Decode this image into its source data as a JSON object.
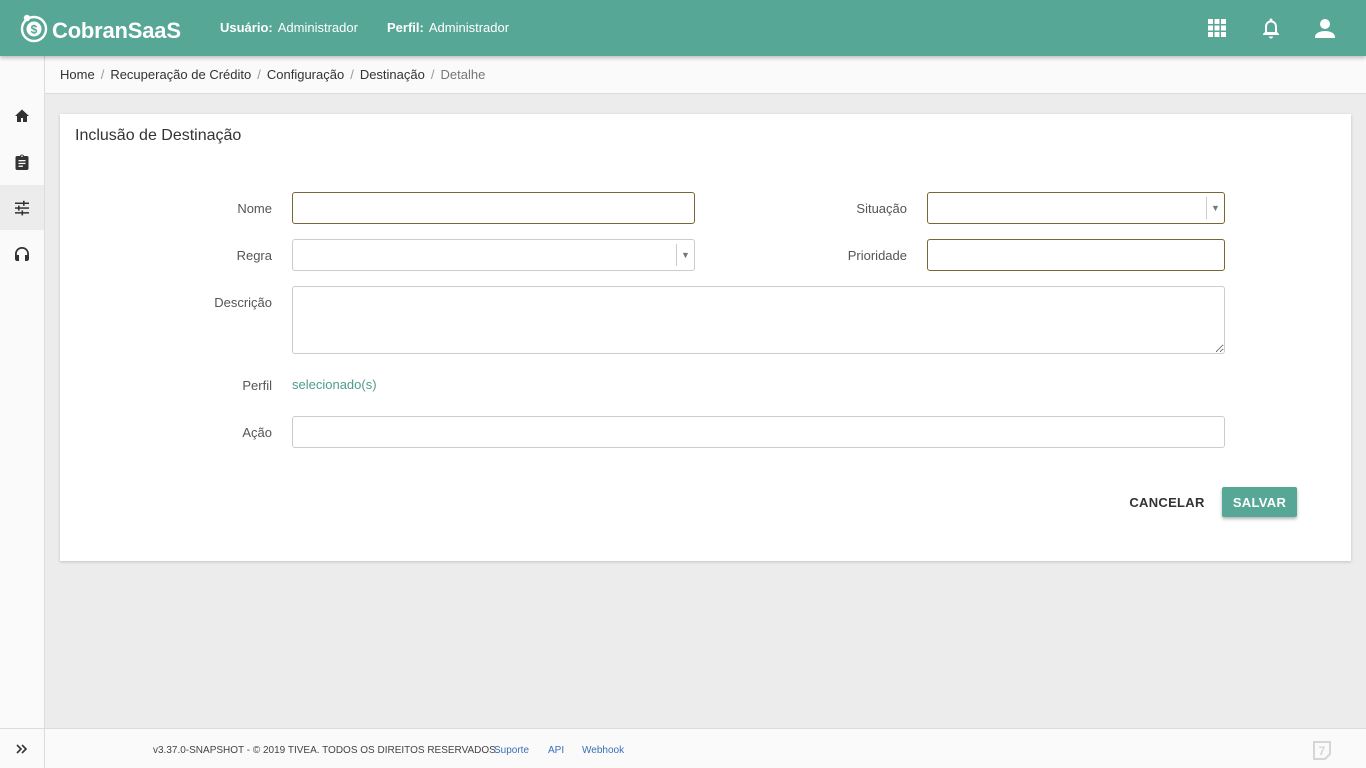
{
  "header": {
    "brand": "CobranSaaS",
    "user_label": "Usuário:",
    "user_value": "Administrador",
    "profile_label": "Perfil:",
    "profile_value": "Administrador",
    "icons": [
      "apps-grid-icon",
      "notification-bell-icon",
      "user-account-icon"
    ],
    "color": "#57a797"
  },
  "breadcrumb": {
    "items": [
      "Home",
      "Recuperação de Crédito",
      "Configuração",
      "Destinação"
    ],
    "current": "Detalhe"
  },
  "sidebar": {
    "items": [
      {
        "icon": "home-icon",
        "active": false
      },
      {
        "icon": "clipboard-icon",
        "active": false
      },
      {
        "icon": "sliders-icon",
        "active": true
      },
      {
        "icon": "headset-icon",
        "active": false
      }
    ],
    "toggle_icon": "double-chevron-right-icon"
  },
  "form": {
    "title": "Inclusão de Destinação",
    "nome_label": "Nome",
    "nome_value": "",
    "situacao_label": "Situação",
    "situacao_value": "",
    "regra_label": "Regra",
    "regra_value": "",
    "prioridade_label": "Prioridade",
    "prioridade_value": "",
    "descricao_label": "Descrição",
    "descricao_value": "",
    "perfil_label": "Perfil",
    "perfil_link": "selecionado(s)",
    "acao_label": "Ação",
    "acao_value": "",
    "cancel_label": "CANCELAR",
    "save_label": "SALVAR"
  },
  "footer": {
    "text": "v3.37.0-SNAPSHOT - © 2019 TIVEA. TODOS OS DIREITOS RESERVADOS.",
    "links": [
      "Suporte",
      "API",
      "Webhook"
    ]
  }
}
